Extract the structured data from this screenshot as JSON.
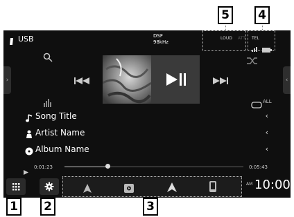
{
  "header": {
    "source_label": "USB",
    "format": "DSF",
    "sample_rate": "98kHz",
    "loud_label": "LOUD",
    "att_label": "ATT",
    "tel_label": "TEL"
  },
  "track": {
    "song_title": "Song Title",
    "artist_name": "Artist Name",
    "album_name": "Album Name"
  },
  "playback": {
    "elapsed": "0:01:23",
    "total": "0:05:43",
    "progress": 0.24,
    "repeat_label": "ALL"
  },
  "clock": {
    "ampm": "AM",
    "time": "10:00"
  },
  "callouts": {
    "c1": "1",
    "c2": "2",
    "c3": "3",
    "c4": "4",
    "c5": "5"
  },
  "icons": [
    "usb-icon",
    "search-icon",
    "prev-icon",
    "play-pause-icon",
    "next-icon",
    "shuffle-icon",
    "equalizer-icon",
    "repeat-icon",
    "note-icon",
    "person-icon",
    "disc-icon",
    "menu-grid-icon",
    "gear-icon",
    "navigation-icon",
    "media-icon",
    "phone-icon",
    "battery-icon",
    "signal-icon"
  ],
  "colors": {
    "screen_bg": "#0f0f0f",
    "panel_bg": "#2a2a2a",
    "text": "#ffffff",
    "callout_border": "#000000"
  }
}
